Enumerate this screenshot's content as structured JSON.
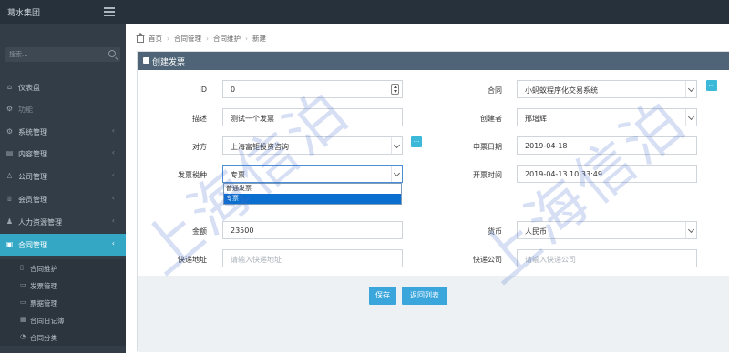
{
  "app": {
    "brand": "葛水集团"
  },
  "search": {
    "placeholder": "搜索..."
  },
  "sidebar": {
    "items": [
      {
        "icon": "home-icon",
        "label": "仪表盘"
      },
      {
        "icon": "gear-icon",
        "label": "功能"
      },
      {
        "icon": "settings-icon",
        "label": "系统管理"
      },
      {
        "icon": "content-icon",
        "label": "内容管理"
      },
      {
        "icon": "company-icon",
        "label": "公司管理"
      },
      {
        "icon": "member-icon",
        "label": "会员管理"
      },
      {
        "icon": "people-icon",
        "label": "人力资源管理"
      },
      {
        "icon": "contract-icon",
        "label": "合同管理"
      }
    ],
    "sub_items": [
      {
        "icon": "file-icon",
        "label": "合同维护"
      },
      {
        "icon": "invoice-icon",
        "label": "发票管理"
      },
      {
        "icon": "receipt-icon",
        "label": "票据管理"
      },
      {
        "icon": "calendar-icon",
        "label": "合同日记簿"
      },
      {
        "icon": "category-icon",
        "label": "合同分类"
      }
    ]
  },
  "breadcrumb": {
    "items": [
      "首页",
      "合同管理",
      "合同维护",
      "新建"
    ]
  },
  "panel": {
    "title": "创建发票"
  },
  "form": {
    "id": {
      "label": "ID",
      "value": "0"
    },
    "contract": {
      "label": "合同",
      "value": "小蚂蚁程序化交易系统"
    },
    "description": {
      "label": "描述",
      "value": "测试一个发票"
    },
    "creator": {
      "label": "创建者",
      "value": "邢增辉"
    },
    "counterparty": {
      "label": "对方",
      "value": "上海富钜投资咨询"
    },
    "apply_date": {
      "label": "申票日期",
      "value": "2019-04-18"
    },
    "invoice_type": {
      "label": "发票税种",
      "value": "专票",
      "options": [
        "普通发票",
        "专票"
      ]
    },
    "issue_time": {
      "label": "开票时间",
      "value": "2019-04-13 10:33:49"
    },
    "amount": {
      "label": "金额",
      "value": "23500"
    },
    "currency": {
      "label": "货币",
      "value": "人民币"
    },
    "express_address": {
      "label": "快递地址",
      "placeholder": "请输入快递地址"
    },
    "express_company": {
      "label": "快递公司",
      "placeholder": "请输入快递公司"
    },
    "mini_button": "..."
  },
  "actions": {
    "save": "保存",
    "back": "返回列表"
  },
  "watermark": "上海信泊"
}
